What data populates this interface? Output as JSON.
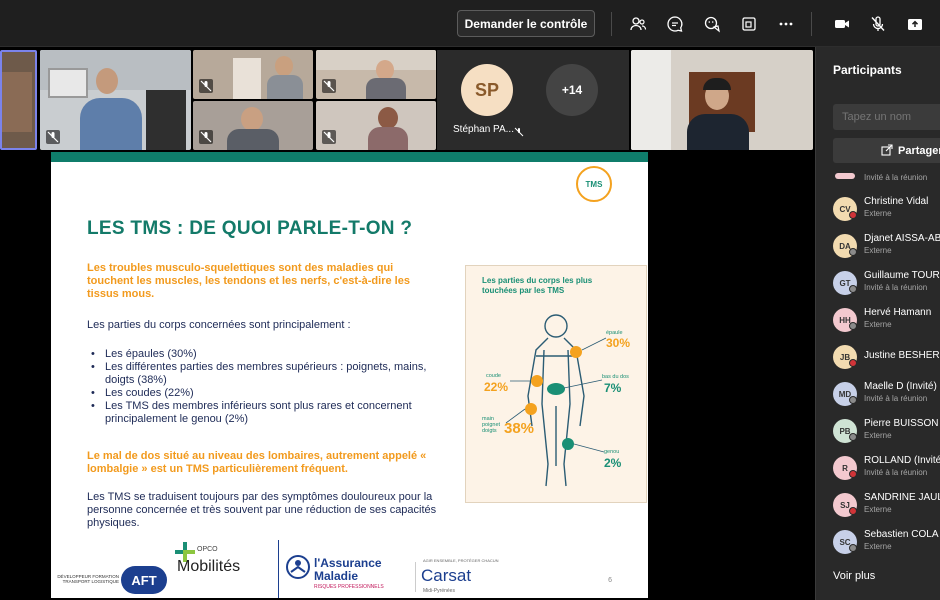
{
  "toolbar": {
    "control_label": "Demander le contrôle",
    "icons": [
      "people-icon",
      "chat-icon",
      "reactions-icon",
      "rooms-icon",
      "more-icon",
      "camera-icon",
      "mic-off-icon",
      "share-tray-icon"
    ]
  },
  "stage": {
    "speaker": {
      "initials": "SP",
      "name": "Stéphan PA...",
      "color": "#f6dfc3"
    },
    "overflow": {
      "label": "+14"
    }
  },
  "slide": {
    "title": "LES TMS : DE QUOI PARLE-T-ON ?",
    "intro": "Les troubles musculo-squelettiques sont  des maladies qui touchent les muscles, les tendons et les nerfs, c'est-à-dire les tissus mous.",
    "lead": "Les parties du corps concernées sont principalement :",
    "bullets": [
      "Les épaules (30%)",
      "Les différentes parties des membres supérieurs : poignets, mains, doigts (38%)",
      "Les coudes (22%)",
      "Les TMS des membres inférieurs sont plus rares et concernent principalement le genou (2%)"
    ],
    "note": "Le mal de dos situé au niveau des lombaires, autrement appelé « lombalgie » est un TMS particulièrement fréquent.",
    "conclusion": "Les TMS se traduisent toujours par des symptômes douloureux pour la personne concernée et très souvent par une réduction de ses capacités physiques.",
    "badge": "TMS",
    "infographic": {
      "title": "Les parties du corps les plus touchées par les TMS",
      "labels": {
        "shoulder": "épaule",
        "shoulder_pct": "30%",
        "elbow": "coude",
        "elbow_pct": "22%",
        "back": "bas du dos",
        "back_pct": "7%",
        "wrist": "main poignet doigts",
        "wrist_pct": "38%",
        "knee": "genou",
        "knee_pct": "2%"
      }
    },
    "logos": {
      "aft": "AFT",
      "aft_sub": "DÉVELOPPEUR FORMATION TRANSPORT LOGISTIQUE",
      "opco_small": "OPCO",
      "opco_big": "Mobilités",
      "am_line1": "l'Assurance",
      "am_line2": "Maladie",
      "am_sub": "RISQUES PROFESSIONNELS",
      "carsat": "Carsat",
      "carsat_top": "AGIR ENSEMBLE, PROTÉGER CHACUN",
      "carsat_region": "Midi-Pyrénées"
    },
    "page": "6"
  },
  "sidebar": {
    "title": "Participants",
    "search_placeholder": "Tapez un nom",
    "share_label": "Partager",
    "top_partial_sub": "Invité à la réunion",
    "participants": [
      {
        "initials": "CV",
        "name": "Christine Vidal",
        "sub": "Externe",
        "color": "#f2dbb0",
        "status": "#d13438"
      },
      {
        "initials": "DA",
        "name": "Djanet AISSA-AB",
        "sub": "Externe",
        "color": "#f2dbb0",
        "status": "#8a8a8a"
      },
      {
        "initials": "GT",
        "name": "Guillaume TOUR",
        "sub": "Invité à la réunion",
        "color": "#c7d0e8",
        "status": "#8a8a8a"
      },
      {
        "initials": "HH",
        "name": "Hervé Hamann",
        "sub": "Externe",
        "color": "#f3c9cf",
        "status": "#8a8a8a"
      },
      {
        "initials": "JB",
        "name": "Justine BESHERS",
        "sub": "",
        "color": "#f2dbb0",
        "status": "#d13438"
      },
      {
        "initials": "MD",
        "name": "Maelle D (Invité)",
        "sub": "Invité à la réunion",
        "color": "#c7d0e8",
        "status": "#8a8a8a"
      },
      {
        "initials": "PB",
        "name": "Pierre BUISSON",
        "sub": "Externe",
        "color": "#cfe3d4",
        "status": "#8a8a8a"
      },
      {
        "initials": "R",
        "name": "ROLLAND (Invité)",
        "sub": "Invité à la réunion",
        "color": "#f3c9cf",
        "status": "#d13438"
      },
      {
        "initials": "SJ",
        "name": "SANDRINE JAUL",
        "sub": "Externe",
        "color": "#f3c9cf",
        "status": "#d13438"
      },
      {
        "initials": "SC",
        "name": "Sebastien COLA",
        "sub": "Externe",
        "color": "#c7d0e8",
        "status": "#8a8a8a"
      }
    ],
    "more_label": "Voir plus"
  }
}
